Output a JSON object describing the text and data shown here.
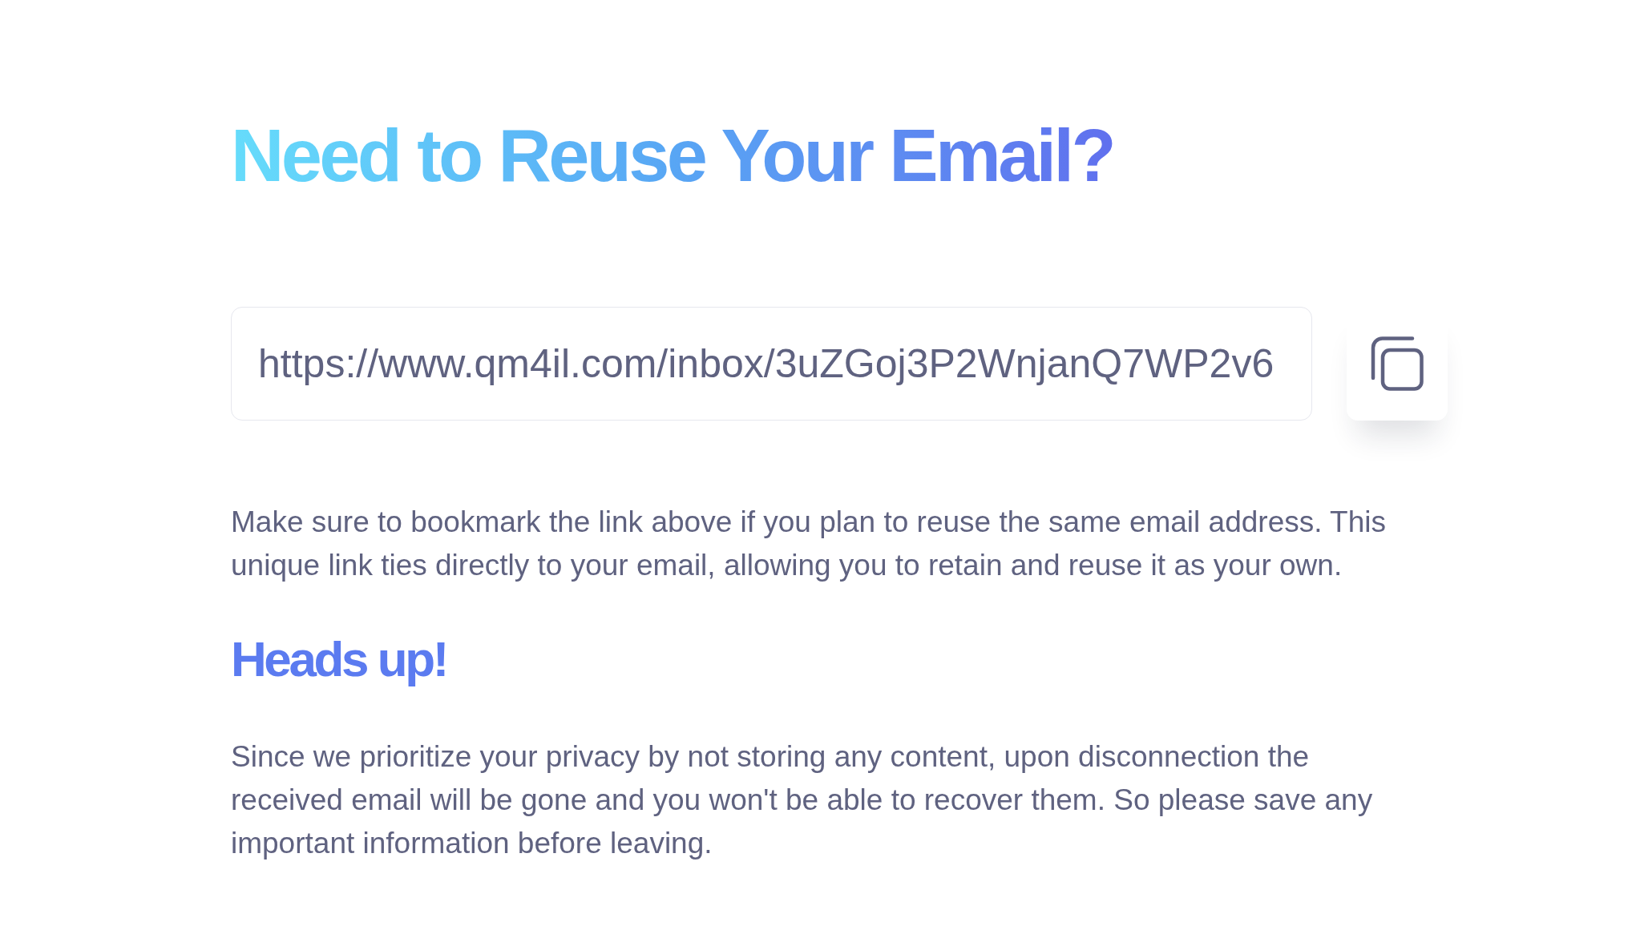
{
  "heading": "Need to Reuse Your Email?",
  "link_field": {
    "value": "https://www.qm4il.com/inbox/3uZGoj3P2WnjanQ7WP2v6"
  },
  "intro": "Make sure to bookmark the link above if you plan to reuse the same email address. This unique link ties directly to your email, allowing you to retain and reuse it as your own.",
  "notice": {
    "title": "Heads up!",
    "text": "Since we prioritize your privacy by not storing any content, upon disconnection the received email will be gone and you won't be able to recover them. So please save any important information before leaving."
  }
}
